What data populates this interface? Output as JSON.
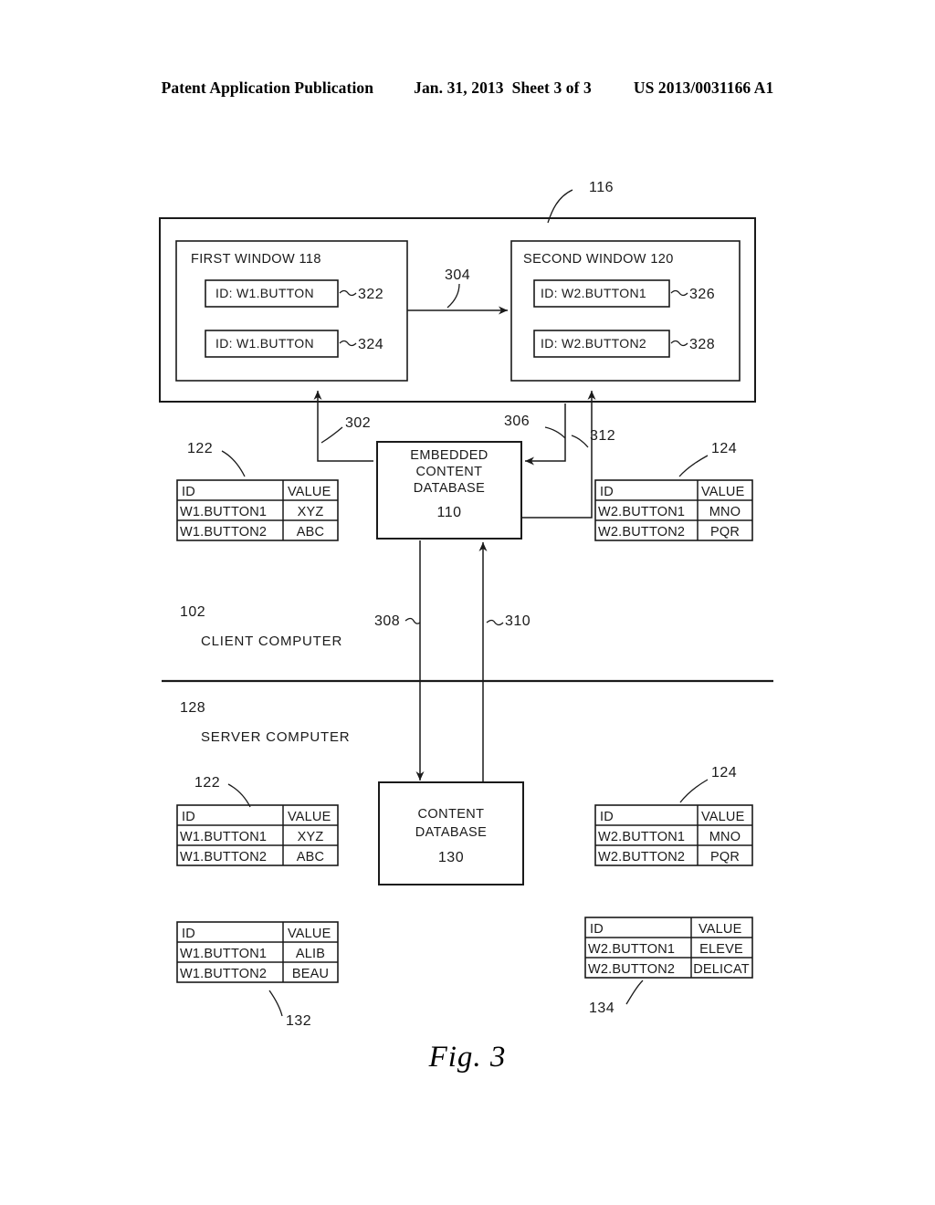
{
  "header": {
    "publication": "Patent Application Publication",
    "date": "Jan. 31, 2013",
    "sheet": "Sheet 3 of 3",
    "document_number": "US 2013/0031166 A1"
  },
  "figure": {
    "caption": "Fig. 3"
  },
  "diagram": {
    "outer_container": {
      "ref": "116"
    },
    "first_window": {
      "title": "FIRST WINDOW 118",
      "buttons": [
        {
          "label": "ID: W1.BUTTON",
          "ref": "322"
        },
        {
          "label": "ID: W1.BUTTON",
          "ref": "324"
        }
      ]
    },
    "second_window": {
      "title": "SECOND WINDOW 120",
      "buttons": [
        {
          "label": "ID: W2.BUTTON1",
          "ref": "326"
        },
        {
          "label": "ID: W2.BUTTON2",
          "ref": "328"
        }
      ]
    },
    "embedded_content_database": {
      "line1": "EMBEDDED",
      "line2": "CONTENT",
      "line3": "DATABASE",
      "ref": "110"
    },
    "content_database": {
      "line1": "CONTENT",
      "line2": "DATABASE",
      "ref": "130"
    },
    "client_computer": {
      "ref": "102",
      "label": "CLIENT COMPUTER"
    },
    "server_computer": {
      "ref": "128",
      "label": "SERVER COMPUTER"
    },
    "connectors": [
      {
        "ref": "302"
      },
      {
        "ref": "304"
      },
      {
        "ref": "306"
      },
      {
        "ref": "308"
      },
      {
        "ref": "310"
      },
      {
        "ref": "312"
      }
    ],
    "tables": {
      "client_w1": {
        "ref": "122",
        "headers": [
          "ID",
          "VALUE"
        ],
        "rows": [
          [
            "W1.BUTTON1",
            "XYZ"
          ],
          [
            "W1.BUTTON2",
            "ABC"
          ]
        ]
      },
      "client_w2": {
        "ref": "124",
        "headers": [
          "ID",
          "VALUE"
        ],
        "rows": [
          [
            "W2.BUTTON1",
            "MNO"
          ],
          [
            "W2.BUTTON2",
            "PQR"
          ]
        ]
      },
      "server_w1": {
        "ref": "122",
        "headers": [
          "ID",
          "VALUE"
        ],
        "rows": [
          [
            "W1.BUTTON1",
            "XYZ"
          ],
          [
            "W1.BUTTON2",
            "ABC"
          ]
        ]
      },
      "server_w2": {
        "ref": "124",
        "headers": [
          "ID",
          "VALUE"
        ],
        "rows": [
          [
            "W2.BUTTON1",
            "MNO"
          ],
          [
            "W2.BUTTON2",
            "PQR"
          ]
        ]
      },
      "server_w1_alt": {
        "ref": "132",
        "headers": [
          "ID",
          "VALUE"
        ],
        "rows": [
          [
            "W1.BUTTON1",
            "ALIB"
          ],
          [
            "W1.BUTTON2",
            "BEAU"
          ]
        ]
      },
      "server_w2_alt": {
        "ref": "134",
        "headers": [
          "ID",
          "VALUE"
        ],
        "rows": [
          [
            "W2.BUTTON1",
            "ELEVE"
          ],
          [
            "W2.BUTTON2",
            "DELICAT"
          ]
        ]
      }
    }
  }
}
